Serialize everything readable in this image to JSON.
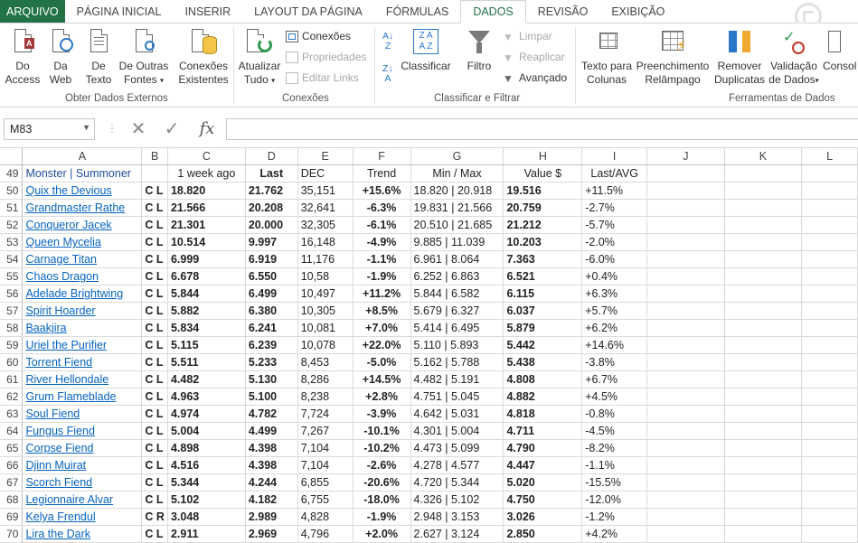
{
  "tabs": [
    {
      "label": "ARQUIVO",
      "key": "file"
    },
    {
      "label": "PÁGINA INICIAL",
      "key": "home"
    },
    {
      "label": "INSERIR",
      "key": "insert"
    },
    {
      "label": "LAYOUT DA PÁGINA",
      "key": "layout"
    },
    {
      "label": "FÓRMULAS",
      "key": "formulas"
    },
    {
      "label": "DADOS",
      "key": "data",
      "active": true
    },
    {
      "label": "REVISÃO",
      "key": "review"
    },
    {
      "label": "EXIBIÇÃO",
      "key": "view"
    }
  ],
  "ribbon": {
    "access": {
      "l1": "Do",
      "l2": "Access"
    },
    "web": {
      "l1": "Da",
      "l2": "Web"
    },
    "text": {
      "l1": "De",
      "l2": "Texto"
    },
    "other": {
      "l1": "De Outras",
      "l2": "Fontes"
    },
    "existing": {
      "l1": "Conexões",
      "l2": "Existentes"
    },
    "refresh": {
      "l1": "Atualizar",
      "l2": "Tudo"
    },
    "connections": "Conexões",
    "properties": "Propriedades",
    "edit_links": "Editar Links",
    "sort_az": "A↓Z",
    "sort": "Classificar",
    "filter": "Filtro",
    "clear": "Limpar",
    "reapply": "Reaplicar",
    "advanced": "Avançado",
    "text_to_cols": {
      "l1": "Texto para",
      "l2": "Colunas"
    },
    "flash_fill": {
      "l1": "Preenchimento",
      "l2": "Relâmpago"
    },
    "remove_dup": {
      "l1": "Remover",
      "l2": "Duplicatas"
    },
    "validation": {
      "l1": "Validação",
      "l2": "de Dados"
    },
    "consolidate": "Consol",
    "groups": {
      "external": "Obter Dados Externos",
      "conn": "Conexões",
      "sortfilter": "Classificar e Filtrar",
      "tools": "Ferramentas de Dados"
    }
  },
  "formula_bar": {
    "name_box": "M83",
    "cancel": "✕",
    "enter": "✓",
    "fx": "fx",
    "formula": ""
  },
  "columns": [
    "A",
    "B",
    "C",
    "D",
    "E",
    "F",
    "G",
    "H",
    "I",
    "J",
    "K",
    "L"
  ],
  "header_row": {
    "row": "49",
    "cells": [
      "Monster | Summoner",
      "",
      "1 week ago",
      "Last",
      "DEC",
      "Trend",
      "Min / Max",
      "Value $",
      "Last/AVG"
    ]
  },
  "rows": [
    {
      "row": "50",
      "name": "Quix the Devious",
      "cl": "C L",
      "week": "18.820",
      "last": "21.762",
      "dec": "35,151",
      "trend": "+15.6%",
      "minmax": "18.820 | 20.918",
      "value": "19.516",
      "lastavg": "+11.5%"
    },
    {
      "row": "51",
      "name": "Grandmaster Rathe",
      "cl": "C L",
      "week": "21.566",
      "last": "20.208",
      "dec": "32,641",
      "trend": "-6.3%",
      "minmax": "19.831 | 21.566",
      "value": "20.759",
      "lastavg": "-2.7%"
    },
    {
      "row": "52",
      "name": "Conqueror Jacek",
      "cl": "C L",
      "week": "21.301",
      "last": "20.000",
      "dec": "32,305",
      "trend": "-6.1%",
      "minmax": "20.510 | 21.685",
      "value": "21.212",
      "lastavg": "-5.7%"
    },
    {
      "row": "53",
      "name": "Queen Mycelia",
      "cl": "C L",
      "week": "10.514",
      "last": "9.997",
      "dec": "16,148",
      "trend": "-4.9%",
      "minmax": "9.885 | 11.039",
      "value": "10.203",
      "lastavg": "-2.0%"
    },
    {
      "row": "54",
      "name": "Carnage Titan",
      "cl": "C L",
      "week": "6.999",
      "last": "6.919",
      "dec": "11,176",
      "trend": "-1.1%",
      "minmax": "6.961 | 8.064",
      "value": "7.363",
      "lastavg": "-6.0%"
    },
    {
      "row": "55",
      "name": "Chaos Dragon",
      "cl": "C L",
      "week": "6.678",
      "last": "6.550",
      "dec": "10,58",
      "trend": "-1.9%",
      "minmax": "6.252 | 6.863",
      "value": "6.521",
      "lastavg": "+0.4%"
    },
    {
      "row": "56",
      "name": "Adelade Brightwing",
      "cl": "C L",
      "week": "5.844",
      "last": "6.499",
      "dec": "10,497",
      "trend": "+11.2%",
      "minmax": "5.844 | 6.582",
      "value": "6.115",
      "lastavg": "+6.3%"
    },
    {
      "row": "57",
      "name": "Spirit Hoarder",
      "cl": "C L",
      "week": "5.882",
      "last": "6.380",
      "dec": "10,305",
      "trend": "+8.5%",
      "minmax": "5.679 | 6.327",
      "value": "6.037",
      "lastavg": "+5.7%"
    },
    {
      "row": "58",
      "name": "Baakjira",
      "cl": "C L",
      "week": "5.834",
      "last": "6.241",
      "dec": "10,081",
      "trend": "+7.0%",
      "minmax": "5.414 | 6.495",
      "value": "5.879",
      "lastavg": "+6.2%"
    },
    {
      "row": "59",
      "name": "Uriel the Purifier",
      "cl": "C L",
      "week": "5.115",
      "last": "6.239",
      "dec": "10,078",
      "trend": "+22.0%",
      "minmax": "5.110 | 5.893",
      "value": "5.442",
      "lastavg": "+14.6%"
    },
    {
      "row": "60",
      "name": "Torrent Fiend",
      "cl": "C L",
      "week": "5.511",
      "last": "5.233",
      "dec": "8,453",
      "trend": "-5.0%",
      "minmax": "5.162 | 5.788",
      "value": "5.438",
      "lastavg": "-3.8%"
    },
    {
      "row": "61",
      "name": "River Hellondale",
      "cl": "C L",
      "week": "4.482",
      "last": "5.130",
      "dec": "8,286",
      "trend": "+14.5%",
      "minmax": "4.482 | 5.191",
      "value": "4.808",
      "lastavg": "+6.7%"
    },
    {
      "row": "62",
      "name": "Grum Flameblade",
      "cl": "C L",
      "week": "4.963",
      "last": "5.100",
      "dec": "8,238",
      "trend": "+2.8%",
      "minmax": "4.751 | 5.045",
      "value": "4.882",
      "lastavg": "+4.5%"
    },
    {
      "row": "63",
      "name": "Soul Fiend",
      "cl": "C L",
      "week": "4.974",
      "last": "4.782",
      "dec": "7,724",
      "trend": "-3.9%",
      "minmax": "4.642 | 5.031",
      "value": "4.818",
      "lastavg": "-0.8%"
    },
    {
      "row": "64",
      "name": "Fungus Fiend",
      "cl": "C L",
      "week": "5.004",
      "last": "4.499",
      "dec": "7,267",
      "trend": "-10.1%",
      "minmax": "4.301 | 5.004",
      "value": "4.711",
      "lastavg": "-4.5%"
    },
    {
      "row": "65",
      "name": "Corpse Fiend",
      "cl": "C L",
      "week": "4.898",
      "last": "4.398",
      "dec": "7,104",
      "trend": "-10.2%",
      "minmax": "4.473 | 5.099",
      "value": "4.790",
      "lastavg": "-8.2%"
    },
    {
      "row": "66",
      "name": "Djinn Muirat",
      "cl": "C L",
      "week": "4.516",
      "last": "4.398",
      "dec": "7,104",
      "trend": "-2.6%",
      "minmax": "4.278 | 4.577",
      "value": "4.447",
      "lastavg": "-1.1%"
    },
    {
      "row": "67",
      "name": "Scorch Fiend",
      "cl": "C L",
      "week": "5.344",
      "last": "4.244",
      "dec": "6,855",
      "trend": "-20.6%",
      "minmax": "4.720 | 5.344",
      "value": "5.020",
      "lastavg": "-15.5%"
    },
    {
      "row": "68",
      "name": "Legionnaire Alvar",
      "cl": "C L",
      "week": "5.102",
      "last": "4.182",
      "dec": "6,755",
      "trend": "-18.0%",
      "minmax": "4.326 | 5.102",
      "value": "4.750",
      "lastavg": "-12.0%"
    },
    {
      "row": "69",
      "name": "Kelya Frendul",
      "cl": "C R",
      "week": "3.048",
      "last": "2.989",
      "dec": "4,828",
      "trend": "-1.9%",
      "minmax": "2.948 | 3.153",
      "value": "3.026",
      "lastavg": "-1.2%"
    },
    {
      "row": "70",
      "name": "Lira the Dark",
      "cl": "C L",
      "week": "2.911",
      "last": "2.969",
      "dec": "4,796",
      "trend": "+2.0%",
      "minmax": "2.627 | 3.124",
      "value": "2.850",
      "lastavg": "+4.2%"
    }
  ]
}
